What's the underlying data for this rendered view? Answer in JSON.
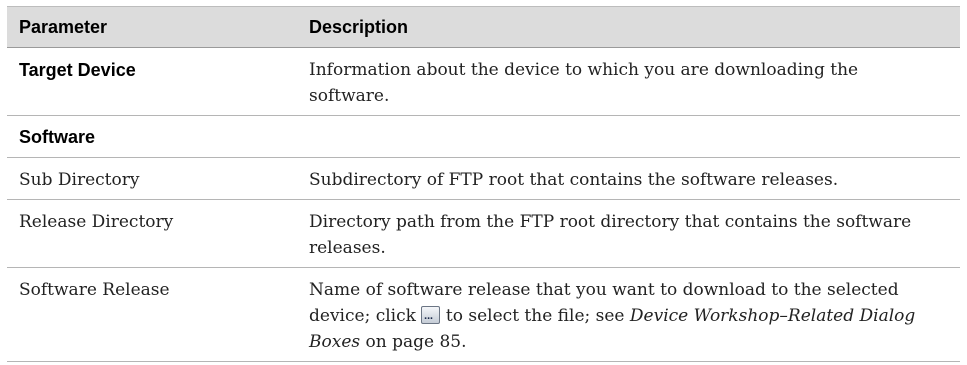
{
  "table": {
    "headers": {
      "parameter": "Parameter",
      "description": "Description"
    },
    "rows": [
      {
        "parameter": "Target Device",
        "description": "Information about the device to which you are downloading the software."
      },
      {
        "parameter": "Software",
        "description": ""
      },
      {
        "parameter": "Sub Directory",
        "description": "Subdirectory of FTP root that contains the software releases."
      },
      {
        "parameter": "Release Directory",
        "description": "Directory path from the FTP root directory that contains the software releases."
      },
      {
        "parameter": "Software Release",
        "description_part1": "Name of software release that you want to download to the selected device; click",
        "description_part2": "to select the file; see",
        "link_text": "Device Workshop–Related Dialog Boxes",
        "description_part3": "on page 85."
      }
    ]
  },
  "icons": {
    "browse": "browse-ellipsis-icon"
  }
}
